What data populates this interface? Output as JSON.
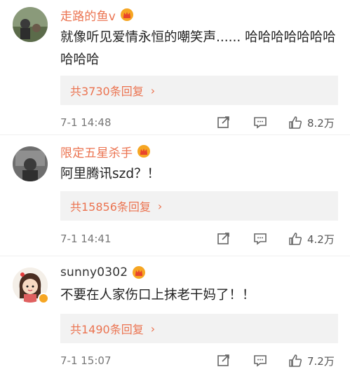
{
  "comments": [
    {
      "username": "走路的鱼v",
      "content": "就像听见爱情永恒的嘲笑声...... 哈哈哈哈哈哈哈哈哈哈",
      "replies_label": "共3730条回复",
      "time": "7-1 14:48",
      "likes": "8.2万",
      "avatar_icon": "avatar-photo-person-outdoors"
    },
    {
      "username": "限定五星杀手",
      "content": "阿里腾讯szd？！",
      "replies_label": "共15856条回复",
      "time": "7-1 14:41",
      "likes": "4.2万",
      "avatar_icon": "avatar-photo-person-in-car"
    },
    {
      "username": "sunny0302",
      "content": "不要在人家伤口上抹老干妈了！！",
      "replies_label": "共1490条回复",
      "time": "7-1 15:07",
      "likes": "7.2万",
      "avatar_icon": "avatar-cartoon-girl"
    }
  ],
  "colors": {
    "username": "#eb7350",
    "reply_link": "#eb7350",
    "reply_bg": "#f2f2f2",
    "badge_gold": "#f6a623"
  },
  "icons": {
    "vip": "crown-badge-icon",
    "repost": "repost-icon",
    "comment": "comment-icon",
    "like": "thumbs-up-icon",
    "more": "chevron-right-icon"
  }
}
